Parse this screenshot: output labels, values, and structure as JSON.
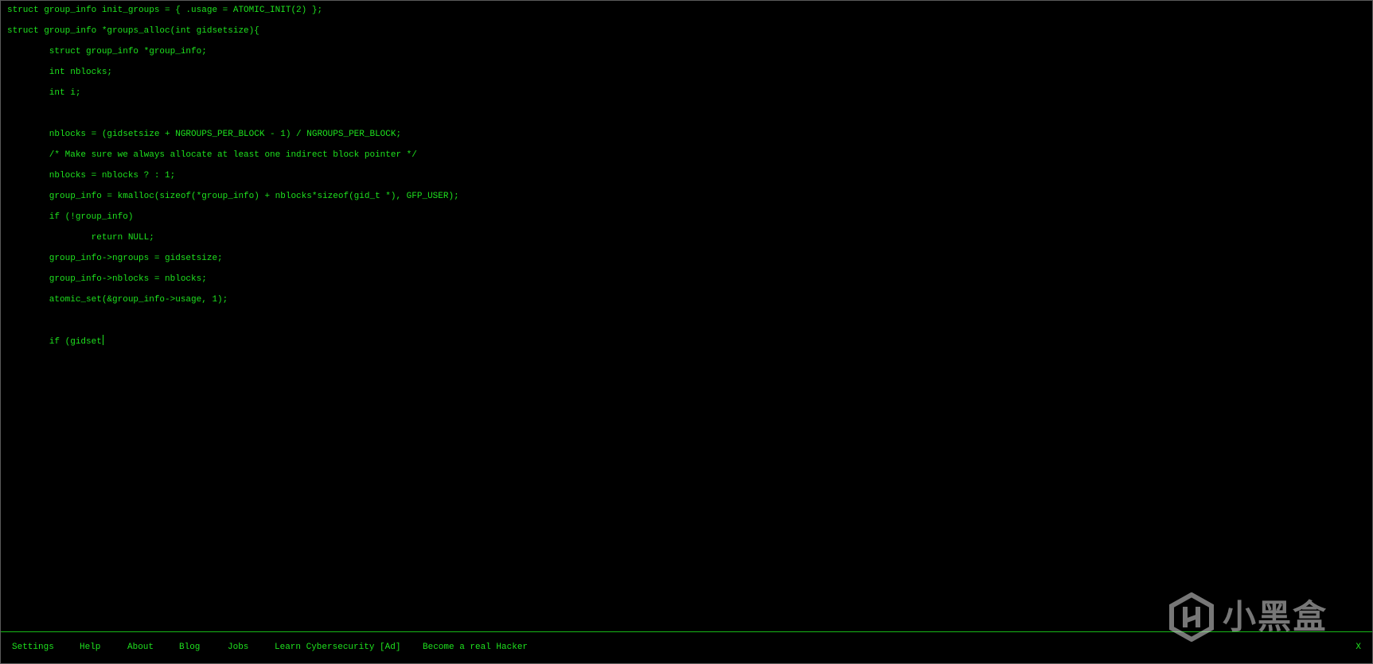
{
  "code": {
    "lines": [
      "struct group_info init_groups = { .usage = ATOMIC_INIT(2) };",
      "struct group_info *groups_alloc(int gidsetsize){",
      "        struct group_info *group_info;",
      "        int nblocks;",
      "        int i;",
      "",
      "        nblocks = (gidsetsize + NGROUPS_PER_BLOCK - 1) / NGROUPS_PER_BLOCK;",
      "        /* Make sure we always allocate at least one indirect block pointer */",
      "        nblocks = nblocks ? : 1;",
      "        group_info = kmalloc(sizeof(*group_info) + nblocks*sizeof(gid_t *), GFP_USER);",
      "        if (!group_info)",
      "                return NULL;",
      "        group_info->ngroups = gidsetsize;",
      "        group_info->nblocks = nblocks;",
      "        atomic_set(&group_info->usage, 1);",
      "",
      "        if (gidset"
    ]
  },
  "footer": {
    "settings": "Settings",
    "help": "Help",
    "about": "About",
    "blog": "Blog",
    "jobs": "Jobs",
    "learn": "Learn Cybersecurity [Ad]",
    "hacker": "Become a real Hacker",
    "close": "X"
  },
  "watermark": {
    "text": "小黑盒"
  },
  "colors": {
    "text_green": "#1ee21e",
    "background": "#000000",
    "rule_green": "#17b817"
  }
}
